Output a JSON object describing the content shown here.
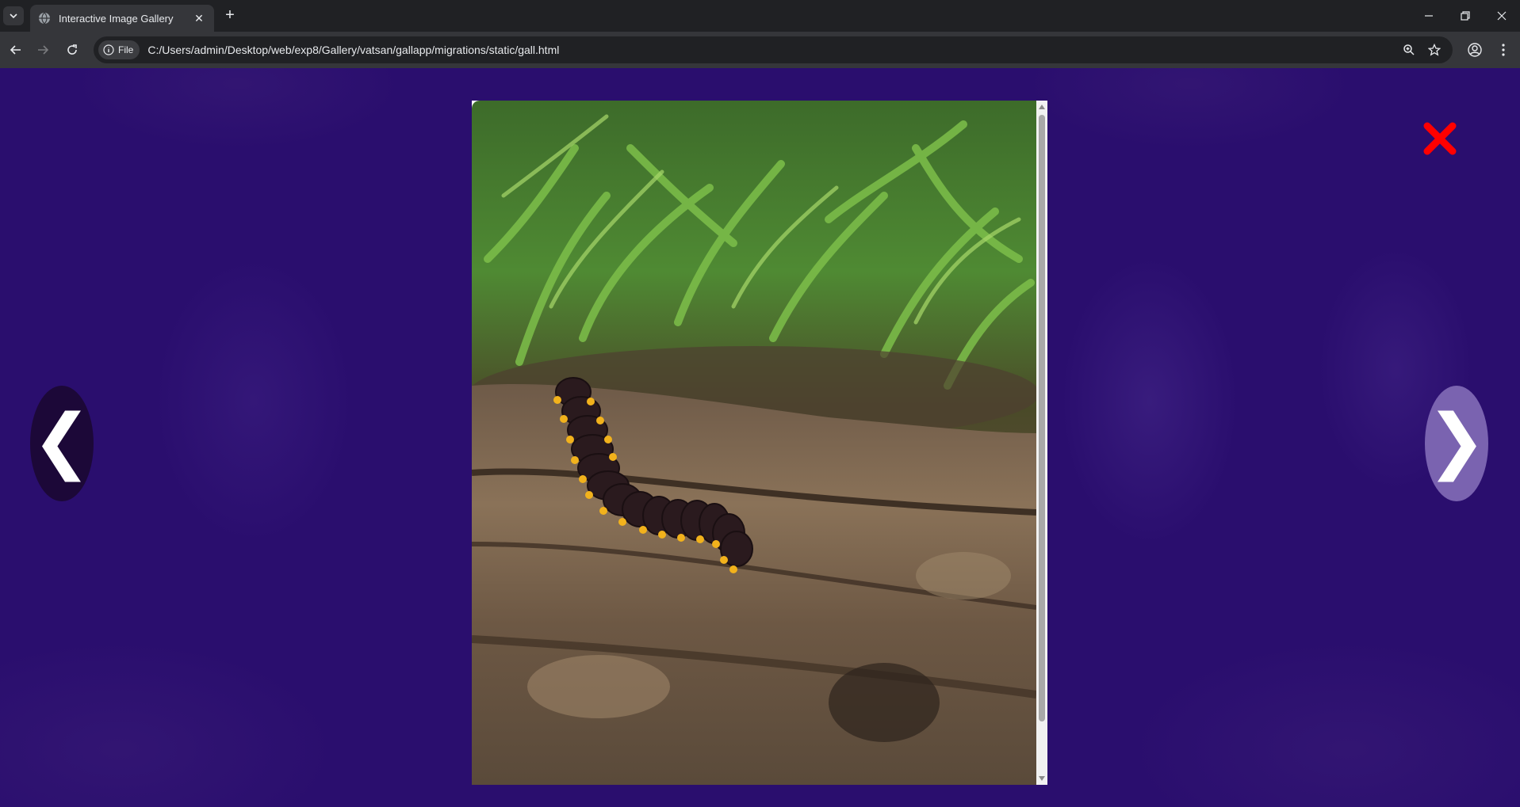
{
  "browser": {
    "tab_title": "Interactive Image Gallery",
    "new_tab_label": "+",
    "security_chip": "File",
    "url": "C:/Users/admin/Desktop/web/exp8/Gallery/vatsan/gallapp/migrations/static/gall.html"
  },
  "gallery": {
    "prev_symbol": "❮",
    "next_symbol": "❯",
    "close_symbol": "✖",
    "close_color": "#ff0000",
    "background_color": "#2a0e6e"
  }
}
